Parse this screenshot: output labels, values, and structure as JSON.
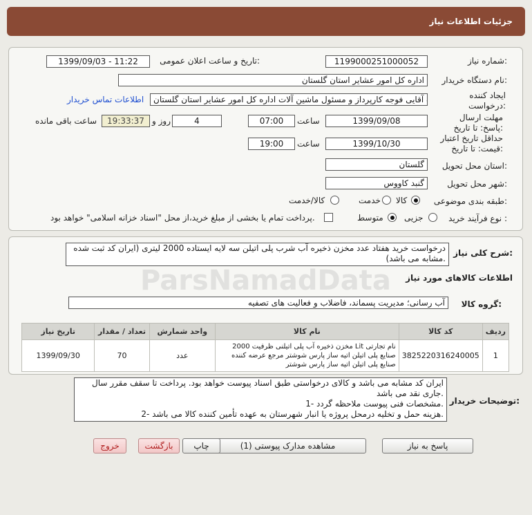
{
  "header": {
    "title": "جزئیات اطلاعات نیاز"
  },
  "form": {
    "need_number_label": "شماره نیاز:",
    "need_number": "1199000251000052",
    "announce_label": "تاریخ و ساعت اعلان عمومی:",
    "announce_value": "1399/09/03 - 11:22",
    "buyer_label": "نام دستگاه خریدار:",
    "buyer_value": "اداره کل امور عشایر استان گلستان",
    "requester_label": "ایجاد کننده درخواست:",
    "requester_value": "کاوه آقایی فوجه کارپرداز و مسئول ماشین آلات اداره کل امور عشایر استان گلستان",
    "contact_link": "اطلاعات تماس خریدار",
    "deadline_label": "مهلت ارسال پاسخ: تا تاریخ:",
    "deadline_date": "1399/09/08",
    "time_label": "ساعت",
    "deadline_time": "07:00",
    "days_value": "4",
    "days_label": "روز و",
    "remaining_time": "19:33:37",
    "remaining_label": "ساعت باقی مانده",
    "validity_label": "حداقل تاریخ اعتبار قیمت: تا تاریخ:",
    "validity_date": "1399/10/30",
    "validity_time": "19:00",
    "province_label": "استان محل تحویل:",
    "province_value": "گلستان",
    "city_label": "شهر محل تحویل:",
    "city_value": "گنبد کاووس",
    "category_label": "طبقه بندی موضوعی:",
    "category_options": [
      "کالا",
      "خدمت",
      "کالا/خدمت"
    ],
    "category_selected": "کالا",
    "process_label": "نوع فرآیند خرید :",
    "process_options": [
      "جزیی",
      "متوسط"
    ],
    "process_selected": "متوسط",
    "payment_text": "پرداخت تمام یا بخشی از مبلغ خرید،از محل \"اسناد خزانه اسلامی\" خواهد بود."
  },
  "summary": {
    "label": "شرح کلی نیاز:",
    "text": "درخواست خرید هفتاد عدد مخزن ذخیره آب شرب پلی اتیلن سه لایه ایستاده 2000 لیتری (ایران کد ثبت شده مشابه می باشد)."
  },
  "goods": {
    "section_title": "اطلاعات کالاهای مورد نیاز",
    "group_label": "گروه کالا:",
    "group_value": "آب رسانی؛ مدیریت پسماند، فاضلاب و فعالیت های تصفیه",
    "columns": [
      "ردیف",
      "کد کالا",
      "نام کالا",
      "واحد شمارش",
      "تعداد / مقدار",
      "تاریخ نیاز"
    ],
    "rows": [
      {
        "row": "1",
        "code": "3825220316240005",
        "name": "مخزن ذخیره آب پلی اتیلنی ظرفیت 2000 Lit نام تجارتی صنایع پلی اتیلن اتیه ساز پارس شوشتر مرجع عرضه کننده صنایع پلی اتیلن اتیه ساز پارس شوشتر",
        "unit": "عدد",
        "qty": "70",
        "date": "1399/09/30"
      }
    ]
  },
  "notes": {
    "label": "توضیحات خریدار:",
    "text": "ایران کد مشابه می باشد و کالای درخواستی طبق اسناد پیوست خواهد بود. پرداخت تا سقف مقرر سال جاری نقد می باشد.\n1- مشخصات فنی پیوست ملاحظه گردد.\n2- هزینه حمل و تخلیه درمحل پروژه یا انبار شهرستان به عهده تأمین کننده کالا می باشد."
  },
  "buttons": {
    "reply": "پاسخ به نیاز",
    "attachments": "مشاهده مدارک پیوستی (1)",
    "print": "چاپ",
    "back": "بازگشت",
    "exit": "خروج"
  },
  "watermark": {
    "text": "ParsNamadData"
  }
}
